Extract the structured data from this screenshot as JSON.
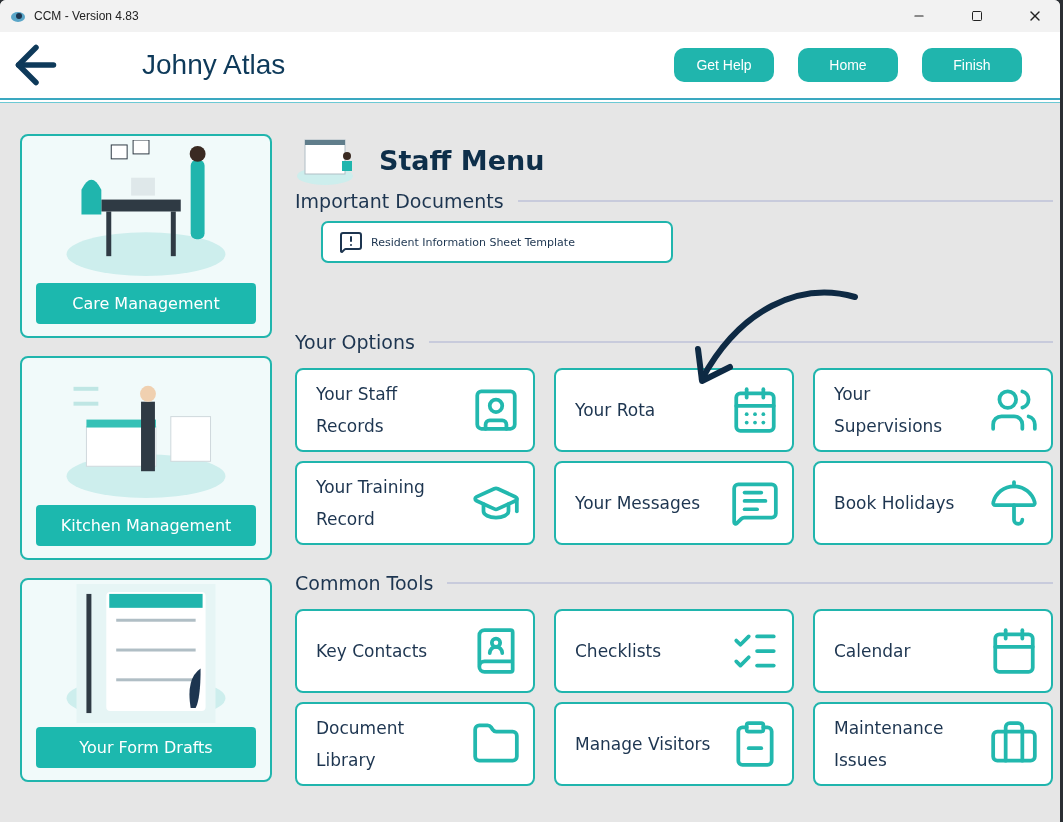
{
  "window": {
    "title": "CCM - Version 4.83"
  },
  "header": {
    "user_name": "Johny Atlas",
    "buttons": [
      "Get Help",
      "Home",
      "Finish"
    ]
  },
  "sidebar": {
    "cards": [
      {
        "label": "Care Management"
      },
      {
        "label": "Kitchen Management"
      },
      {
        "label": "Your Form Drafts"
      }
    ]
  },
  "main": {
    "title": "Staff Menu",
    "important_documents": {
      "heading": "Important Documents",
      "items": [
        "Resident Information Sheet Template"
      ]
    },
    "your_options": {
      "heading": "Your Options",
      "tiles": [
        {
          "label": "Your Staff Records"
        },
        {
          "label": "Your Rota"
        },
        {
          "label": "Your Supervisions"
        },
        {
          "label": "Your Training Record"
        },
        {
          "label": "Your Messages"
        },
        {
          "label": "Book Holidays"
        }
      ]
    },
    "common_tools": {
      "heading": "Common Tools",
      "tiles": [
        {
          "label": "Key Contacts"
        },
        {
          "label": "Checklists"
        },
        {
          "label": "Calendar"
        },
        {
          "label": "Document Library"
        },
        {
          "label": "Manage Visitors"
        },
        {
          "label": "Maintenance Issues"
        }
      ]
    }
  }
}
